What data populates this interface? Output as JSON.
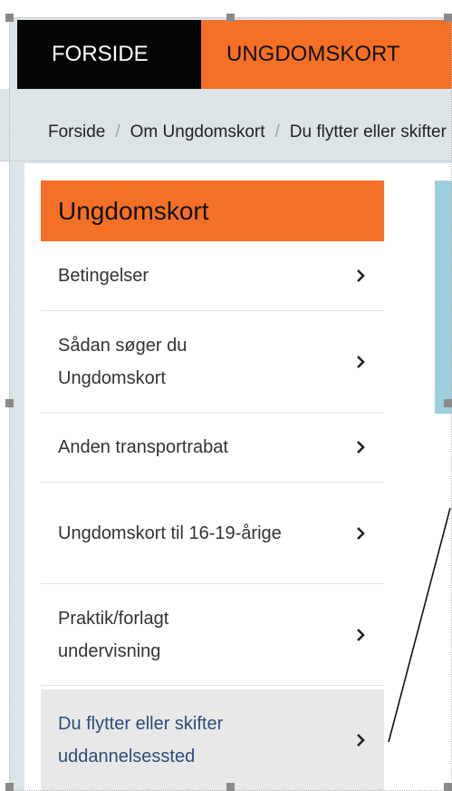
{
  "nav": {
    "home": "FORSIDE",
    "section": "UNGDOMSKORT"
  },
  "breadcrumb": {
    "items": [
      "Forside",
      "Om Ungdomskort",
      "Du flytter eller skifter uddannelsessted"
    ],
    "separator": "/"
  },
  "sidebar": {
    "heading": "Ungdomskort",
    "items": [
      {
        "label": "Betingelser"
      },
      {
        "label": "Sådan søger du Ungdomskort"
      },
      {
        "label": "Anden transportrabat"
      },
      {
        "label": "Ungdomskort til 16-19-årige"
      },
      {
        "label": "Praktik/forlagt undervisning"
      },
      {
        "label": "Du flytter eller skifter uddannelsessted",
        "active": true
      }
    ]
  },
  "colors": {
    "brand_orange": "#f47026",
    "nav_black": "#050505",
    "active_link": "#2c4d7b",
    "panel_teal": "#9ccfdd"
  },
  "icons": {
    "item_arrow": "chevron-right-icon"
  }
}
